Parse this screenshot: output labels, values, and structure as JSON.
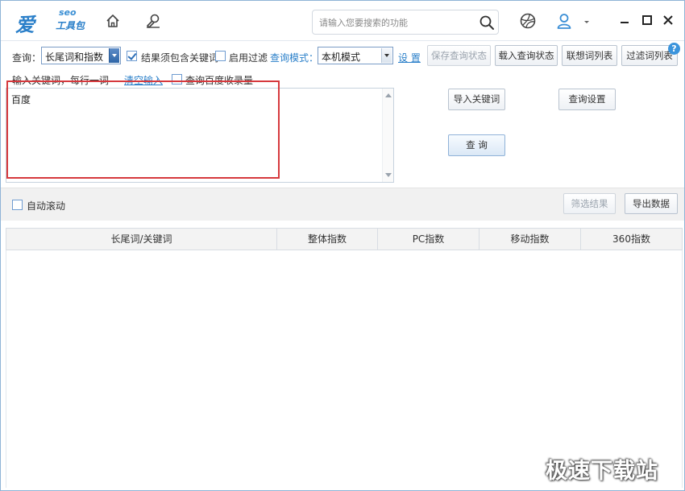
{
  "app": {
    "logo_main": "爱站",
    "logo_seo": "seo",
    "logo_sub": "工具包"
  },
  "search": {
    "placeholder": "请输入您要搜索的功能"
  },
  "toolbar": {
    "query_label": "查询：",
    "query_type_value": "长尾词和指数",
    "must_contain_label": "结果须包含关键词",
    "must_contain_checked": true,
    "filter_label": "启用过滤",
    "filter_checked": false,
    "mode_label": "查询模式：",
    "mode_value": "本机模式",
    "settings_link": "设 置",
    "save_state": "保存查询状态",
    "load_state": "载入查询状态",
    "suggest_list": "联想词列表",
    "filter_list": "过滤词列表",
    "help": "?"
  },
  "input_area": {
    "instruction": "输入关键词，每行一词",
    "clear_link": "清空输入",
    "baidu_index_label": "查询百度收录量",
    "keyword_text": "百度"
  },
  "actions": {
    "import_keywords": "导入关键词",
    "query_settings": "查询设置",
    "query": "查 询"
  },
  "band": {
    "auto_scroll_label": "自动滚动",
    "filter_results": "筛选结果",
    "export_data": "导出数据"
  },
  "table": {
    "columns": [
      "长尾词/关键词",
      "整体指数",
      "PC指数",
      "移动指数",
      "360指数"
    ]
  },
  "watermark": "极速下载站"
}
